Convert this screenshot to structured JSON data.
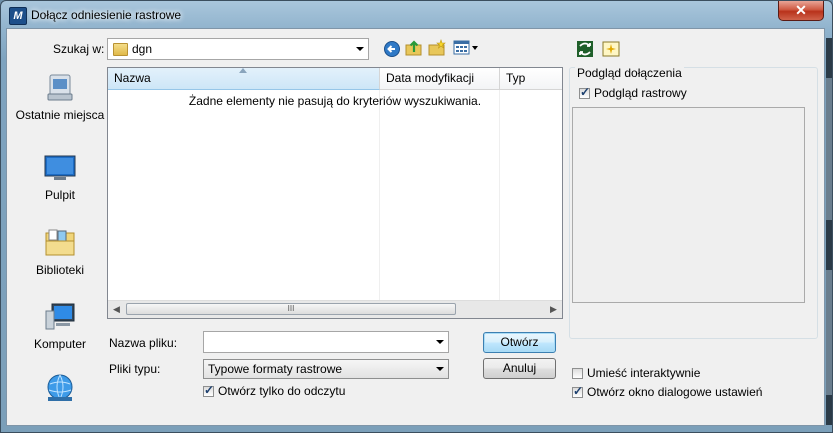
{
  "window": {
    "title": "Dołącz odniesienie rastrowe",
    "close_label": "✕"
  },
  "lookin": {
    "label": "Szukaj w:",
    "value": "dgn"
  },
  "places": [
    {
      "label": "Ostatnie miejsca",
      "icon": "recent-places-icon"
    },
    {
      "label": "Pulpit",
      "icon": "desktop-icon"
    },
    {
      "label": "Biblioteki",
      "icon": "libraries-icon"
    },
    {
      "label": "Komputer",
      "icon": "computer-icon"
    },
    {
      "label": "",
      "icon": "network-icon"
    }
  ],
  "list": {
    "columns": [
      "Nazwa",
      "Data modyfikacji",
      "Typ"
    ],
    "empty_message": "Żadne elementy nie pasują do kryteriów wyszukiwania.",
    "scroll_grip": "III"
  },
  "filename": {
    "label": "Nazwa pliku:",
    "value": ""
  },
  "filetype": {
    "label": "Pliki typu:",
    "value": "Typowe formaty rastrowe"
  },
  "readonly": {
    "label": "Otwórz tylko do odczytu",
    "checked": true
  },
  "buttons": {
    "open": "Otwórz",
    "cancel": "Anuluj"
  },
  "preview": {
    "group_title": "Podgląd dołączenia",
    "raster_preview": {
      "label": "Podgląd rastrowy",
      "checked": true
    }
  },
  "options": {
    "interactive": {
      "label": "Umieść interaktywnie",
      "checked": false
    },
    "settings_dialog": {
      "label": "Otwórz okno dialogowe ustawień",
      "checked": true
    }
  },
  "colors": {
    "accent": "#3c7fb1",
    "close": "#c8432a"
  }
}
